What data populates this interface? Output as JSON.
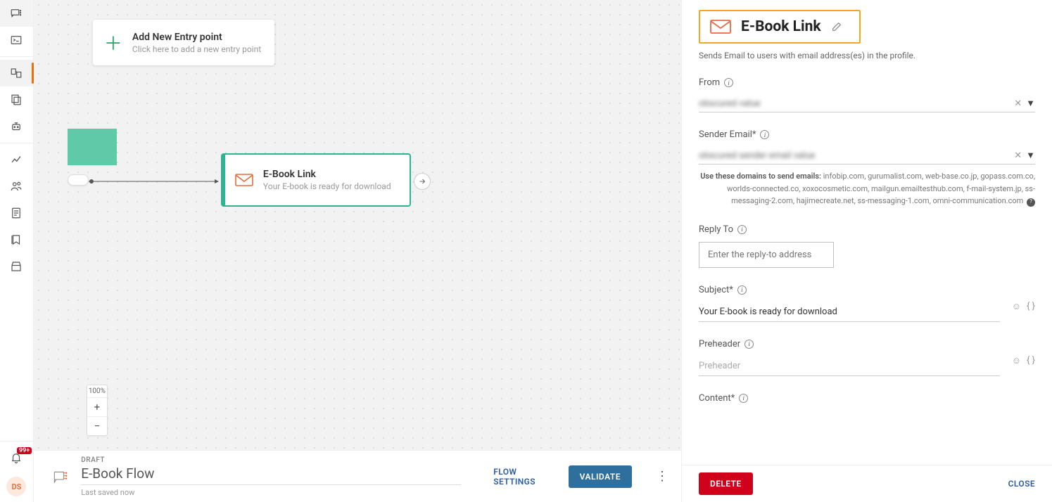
{
  "sidebar": {
    "notification_badge": "99+",
    "avatar_initials": "DS"
  },
  "canvas": {
    "entry_card": {
      "title": "Add New Entry point",
      "subtitle": "Click here to add a new entry point"
    },
    "email_node": {
      "title": "E-Book Link",
      "subtitle": "Your E-book is ready for download"
    },
    "zoom": {
      "level": "100%",
      "plus": "+",
      "minus": "−"
    }
  },
  "footer": {
    "status": "DRAFT",
    "flow_name": "E-Book Flow",
    "saved": "Last saved now",
    "flow_settings": "FLOW SETTINGS",
    "validate": "VALIDATE"
  },
  "panel": {
    "title": "E-Book Link",
    "description": "Sends Email to users with email address(es) in the profile.",
    "from": {
      "label": "From",
      "value": "obscured value"
    },
    "sender_email": {
      "label": "Sender Email*",
      "value": "obscured sender email value",
      "hint_prefix": "Use these domains to send emails:",
      "hint_domains": "infobip.com, gurumalist.com, web-base.co.jp, gopass.com.co, worlds-connected.co, xoxocosmetic.com, mailgun.emailtesthub.com, f-mail-system.jp, ss-messaging-2.com, hajimecreate.net, ss-messaging-1.com, omni-communication.com"
    },
    "reply_to": {
      "label": "Reply To",
      "placeholder": "Enter the reply-to address",
      "value": ""
    },
    "subject": {
      "label": "Subject*",
      "value": "Your E-book is ready for download"
    },
    "preheader": {
      "label": "Preheader",
      "placeholder": "Preheader",
      "value": ""
    },
    "content": {
      "label": "Content*"
    },
    "delete": "DELETE",
    "close": "CLOSE"
  }
}
